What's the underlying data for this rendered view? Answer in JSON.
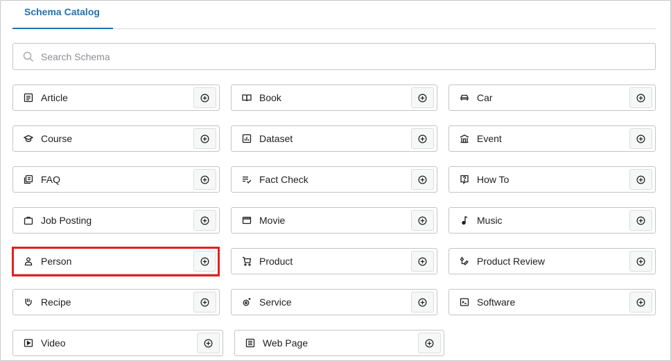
{
  "tabs": [
    {
      "label": "Schema Catalog"
    }
  ],
  "search": {
    "placeholder": "Search Schema",
    "value": ""
  },
  "schemas": [
    {
      "label": "Article",
      "icon": "document-icon"
    },
    {
      "label": "Book",
      "icon": "book-icon"
    },
    {
      "label": "Car",
      "icon": "car-icon"
    },
    {
      "label": "Course",
      "icon": "graduation-cap-icon"
    },
    {
      "label": "Dataset",
      "icon": "chart-icon"
    },
    {
      "label": "Event",
      "icon": "building-icon"
    },
    {
      "label": "FAQ",
      "icon": "faq-icon"
    },
    {
      "label": "Fact Check",
      "icon": "checklist-icon"
    },
    {
      "label": "How To",
      "icon": "help-icon"
    },
    {
      "label": "Job Posting",
      "icon": "briefcase-icon"
    },
    {
      "label": "Movie",
      "icon": "film-icon"
    },
    {
      "label": "Music",
      "icon": "music-note-icon"
    },
    {
      "label": "Person",
      "icon": "person-icon"
    },
    {
      "label": "Product",
      "icon": "cart-icon"
    },
    {
      "label": "Product Review",
      "icon": "review-icon"
    },
    {
      "label": "Recipe",
      "icon": "chef-hand-icon"
    },
    {
      "label": "Service",
      "icon": "service-gear-icon"
    },
    {
      "label": "Software",
      "icon": "terminal-icon"
    },
    {
      "label": "Video",
      "icon": "video-icon"
    },
    {
      "label": "Web Page",
      "icon": "web-page-icon"
    }
  ],
  "colors": {
    "accent": "#2271b1",
    "highlight": "#e61e1e",
    "border": "#c3c4c7"
  }
}
